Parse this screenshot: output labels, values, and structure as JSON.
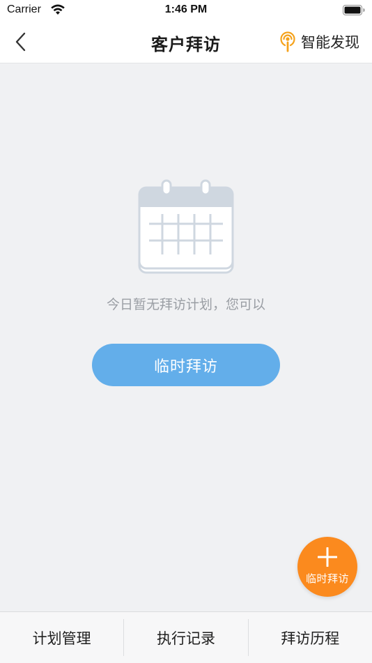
{
  "status_bar": {
    "carrier": "Carrier",
    "time": "1:46 PM",
    "wifi_icon": "wifi-icon",
    "battery_icon": "battery-icon"
  },
  "nav_bar": {
    "back_icon": "chevron-left-icon",
    "title": "客户拜访",
    "discover_label": "智能发现",
    "discover_icon": "smart-discover-icon"
  },
  "empty_state": {
    "icon": "calendar-icon",
    "message": "今日暂无拜访计划，您可以",
    "button_label": "临时拜访"
  },
  "fab": {
    "icon": "plus-icon",
    "label": "临时拜访"
  },
  "tab_bar": {
    "items": [
      {
        "label": "计划管理"
      },
      {
        "label": "执行记录"
      },
      {
        "label": "拜访历程"
      }
    ]
  },
  "colors": {
    "background": "#f0f1f3",
    "primary_button": "#63aeea",
    "fab": "#fb8a1e",
    "discover_accent": "#f5a21b",
    "empty_text": "#9a9ea4",
    "calendar_stroke": "#cfd7e0"
  }
}
